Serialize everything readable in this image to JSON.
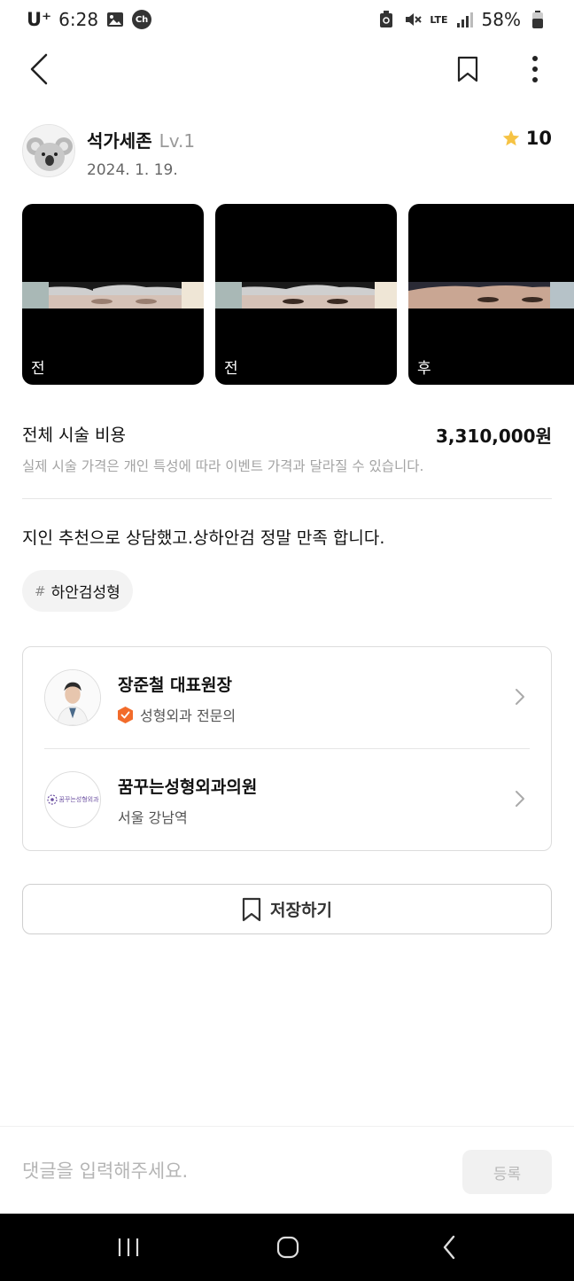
{
  "status_bar": {
    "carrier": "U⁺",
    "time": "6:28",
    "chat_badge": "Ch",
    "network": "LTE",
    "battery": "58%"
  },
  "author": {
    "name": "석가세존",
    "level": "Lv.1",
    "date": "2024. 1. 19.",
    "rating": "10"
  },
  "photos": [
    {
      "label": "전"
    },
    {
      "label": "전"
    },
    {
      "label": "후"
    }
  ],
  "cost": {
    "label": "전체 시술 비용",
    "value": "3,310,000원",
    "note": "실제 시술 가격은 개인 특성에 따라 이벤트 가격과 달라질 수 있습니다."
  },
  "review": {
    "text": "지인 추천으로 상담했고.상하안검 정말 만족 합니다.",
    "tag_hash": "#",
    "tag": "하안검성형"
  },
  "doctor": {
    "name": "장준철 대표원장",
    "specialty": "성형외과 전문의"
  },
  "clinic": {
    "name": "꿈꾸는성형외과의원",
    "location": "서울 강남역",
    "logo_text": "꿈꾸는성형외과"
  },
  "save_button": {
    "label": "저장하기"
  },
  "comment": {
    "placeholder": "댓글을 입력해주세요.",
    "submit_label": "등록"
  },
  "colors": {
    "star": "#f6c344",
    "badge_orange": "#f26b2a",
    "accent_text": "#111111"
  }
}
